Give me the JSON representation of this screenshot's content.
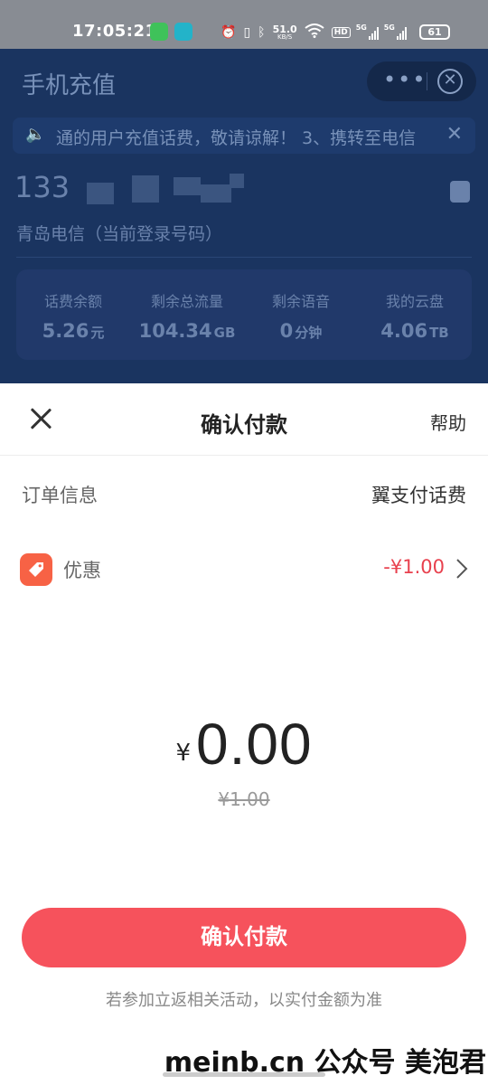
{
  "status_bar": {
    "time": "17:05:21",
    "net_speed_value": "51.0",
    "net_speed_unit": "KB/S",
    "hd_label": "HD",
    "signal1_label": "5G",
    "signal2_label": "5G",
    "battery": "61"
  },
  "background_page": {
    "title": "手机充值",
    "capsule_menu": "•••",
    "notice_text": "通的用户充值话费，敬请谅解！ 3、携转至电信",
    "phone_prefix": "133",
    "carrier": "青岛电信（当前登录号码）",
    "stats": [
      {
        "label": "话费余额",
        "value": "5.26",
        "unit": "元"
      },
      {
        "label": "剩余总流量",
        "value": "104.34",
        "unit": "GB"
      },
      {
        "label": "剩余语音",
        "value": "0",
        "unit": "分钟"
      },
      {
        "label": "我的云盘",
        "value": "4.06",
        "unit": "TB"
      }
    ]
  },
  "sheet": {
    "title": "确认付款",
    "help": "帮助",
    "order_label": "订单信息",
    "order_value": "翼支付话费",
    "coupon_label": "优惠",
    "coupon_value": "-¥1.00",
    "currency": "¥",
    "amount": "0.00",
    "original_price": "¥1.00",
    "confirm_button": "确认付款",
    "note": "若参加立返相关活动，以实付金额为准"
  },
  "watermark": "meinb.cn  公众号 美泡君",
  "colors": {
    "accent_red": "#f6525c",
    "discount_red": "#e8414e",
    "coupon_icon": "#f76245"
  }
}
